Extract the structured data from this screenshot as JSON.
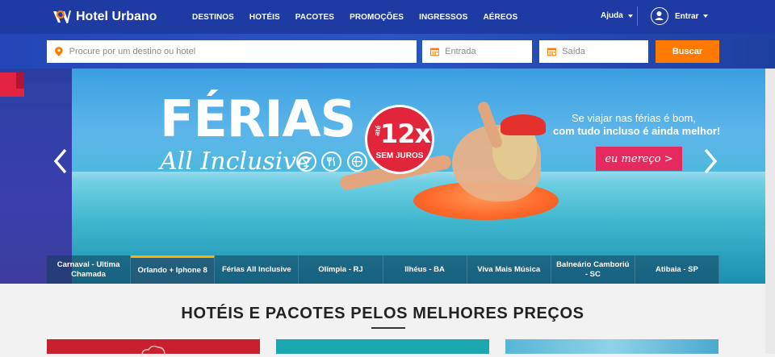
{
  "header": {
    "logo_text": "Hotel Urbano",
    "nav": [
      "DESTINOS",
      "HOTÉIS",
      "PACOTES",
      "PROMOÇÕES",
      "INGRESSOS",
      "AÉREOS"
    ],
    "help_label": "Ajuda",
    "login_label": "Entrar"
  },
  "search": {
    "destination_placeholder": "Procure por um destino ou hotel",
    "checkin_placeholder": "Entrada",
    "checkout_placeholder": "Saída",
    "button_label": "Buscar"
  },
  "hero": {
    "headline": "FÉRIAS",
    "subheadline": "All Inclusive",
    "badge_prefix": "até",
    "badge_value": "12x",
    "badge_suffix": "SEM JUROS",
    "tagline_line1": "Se viajar nas férias é bom,",
    "tagline_line2": "com tudo incluso é ainda melhor!",
    "cta_label": "eu mereço >"
  },
  "tabs": [
    "Carnaval - Ultima Chamada",
    "Orlando + Iphone 8",
    "Férias All Inclusive",
    "Olímpia - RJ",
    "Ilhéus - BA",
    "Viva Mais Música",
    "Balneário Camboriú - SC",
    "Atibaia - SP"
  ],
  "active_tab_index": 1,
  "section": {
    "title": "HOTÉIS E PACOTES PELOS MELHORES PREÇOS"
  },
  "colors": {
    "header_bg": "#1e3aa3",
    "accent_orange": "#ff7a00",
    "cta_pink": "#e42a5f",
    "badge_red": "#e1253a",
    "active_tab_border": "#ffb000"
  }
}
